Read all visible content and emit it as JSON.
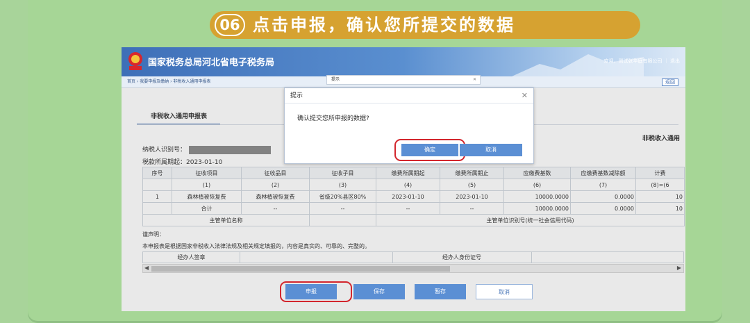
{
  "banner": {
    "step": "06",
    "title": "点击申报，确认您所提交的数据"
  },
  "header": {
    "site_name": "国家税务总局河北省电子税务局",
    "user_info": "欢迎，测试张华庭有限公司 ｜ 退出"
  },
  "breadcrumb": {
    "path": "首页 › 我要申报及缴纳 › 非税收入通用申报表",
    "back_label": "返回"
  },
  "tab": {
    "label": "非税收入通用申报表"
  },
  "form": {
    "right_title": "非税收入通用",
    "taxpayer_id_label": "纳税人识别号：",
    "period_label": "税款所属期起：2023-01-10"
  },
  "table": {
    "headers": [
      "序号",
      "征收项目",
      "征收品目",
      "征收子目",
      "缴费所属期起",
      "缴费所属期止",
      "应缴费基数",
      "应缴费基数减除额",
      "计费"
    ],
    "index_row": [
      "",
      "(1)",
      "(2)",
      "(3)",
      "(4)",
      "(5)",
      "(6)",
      "(7)",
      "(8)=(6"
    ],
    "rows": [
      [
        "1",
        "森林植被恢复费",
        "森林植被恢复费",
        "省级20%县区80%",
        "2023-01-10",
        "2023-01-10",
        "10000.0000",
        "0.0000",
        "10"
      ],
      [
        "",
        "合计",
        "--",
        "--",
        "--",
        "--",
        "10000.0000",
        "0.0000",
        "10"
      ]
    ],
    "org_name_label": "主管单位名称",
    "org_code_label": "主管单位识别号(统一社会信用代码)"
  },
  "declaration": {
    "title": "谨声明：",
    "text": "本申报表是根据国家非税收入法律法规及相关规定填报的，内容是真实的、可靠的、完整的。",
    "signer_label": "经办人签章",
    "signer_id_label": "经办人身份证号"
  },
  "buttons": {
    "submit": "申报",
    "save": "保存",
    "draft": "暂存",
    "cancel": "取消"
  },
  "top_dialog_bar": {
    "title": "提示"
  },
  "dialog": {
    "title": "提示",
    "message": "确认提交您所申报的数据?",
    "ok": "确定",
    "cancel": "取消"
  },
  "colors": {
    "banner": "#d6a231",
    "highlight": "#d3262d",
    "button": "#5b8fd4",
    "background": "#a8d49a"
  }
}
